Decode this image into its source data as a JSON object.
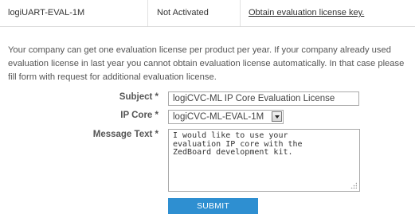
{
  "license_row": {
    "product": "logiUART-EVAL-1M",
    "status": "Not Activated",
    "action_link": "Obtain evaluation license key."
  },
  "intro": {
    "line1": "Your company can get one evaluation license per product per year. If your company already used",
    "line2": "evaluation license in last year you cannot obtain evaluation license automatically. In that case please",
    "line3": "fill form with request for additional evaluation license."
  },
  "form": {
    "subject_label": "Subject *",
    "subject_value": "logiCVC-ML IP Core Evaluation License",
    "ipcore_label": "IP Core *",
    "ipcore_selected": "logiCVC-ML-EVAL-1M",
    "message_label": "Message Text *",
    "message_lines": [
      "I would like to use your",
      "evaluation IP core with the",
      "ZedBoard development kit."
    ],
    "submit_label": "SUBMIT"
  },
  "colors": {
    "submit_bg": "#2e8fd1",
    "text": "#555555"
  }
}
